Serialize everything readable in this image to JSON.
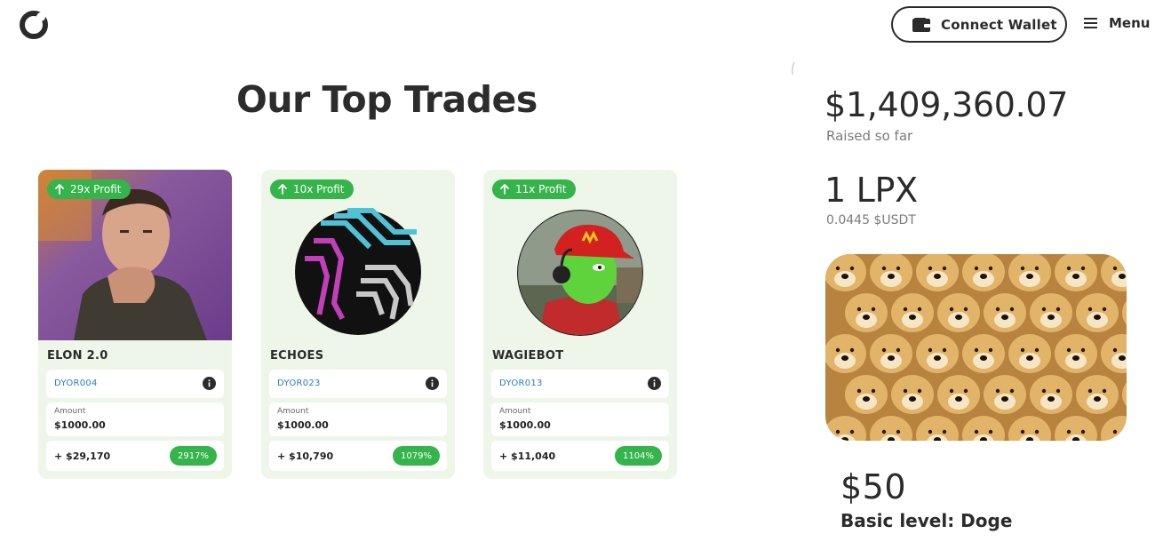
{
  "header": {
    "connect_label": "Connect Wallet",
    "menu_label": "Menu"
  },
  "section_title": "Our Top Trades",
  "trades": [
    {
      "badge": "29x Profit",
      "name": "ELON 2.0",
      "code": "DYOR004",
      "amount_label": "Amount",
      "amount": "$1000.00",
      "gain": "+ $29,170",
      "percent": "2917%"
    },
    {
      "badge": "10x Profit",
      "name": "ECHOES",
      "code": "DYOR023",
      "amount_label": "Amount",
      "amount": "$1000.00",
      "gain": "+ $10,790",
      "percent": "1079%"
    },
    {
      "badge": "11x Profit",
      "name": "WAGIEBOT",
      "code": "DYOR013",
      "amount_label": "Amount",
      "amount": "$1000.00",
      "gain": "+ $11,040",
      "percent": "1104%"
    }
  ],
  "presale": {
    "raised_value": "$1,409,360.07",
    "raised_label": "Raised so far",
    "token_unit": "1 LPX",
    "token_price": "0.0445 $USDT",
    "tier_price": "$50",
    "tier_level": "Basic level: Doge"
  },
  "colors": {
    "accent_green": "#34b44a",
    "card_bg": "#eef6e9",
    "code_blue": "#2a7fc2",
    "text_dark": "#2b2b2b"
  },
  "icons": [
    "logo-icon",
    "wallet-icon",
    "hamburger-icon",
    "arrow-up-icon",
    "info-icon"
  ]
}
